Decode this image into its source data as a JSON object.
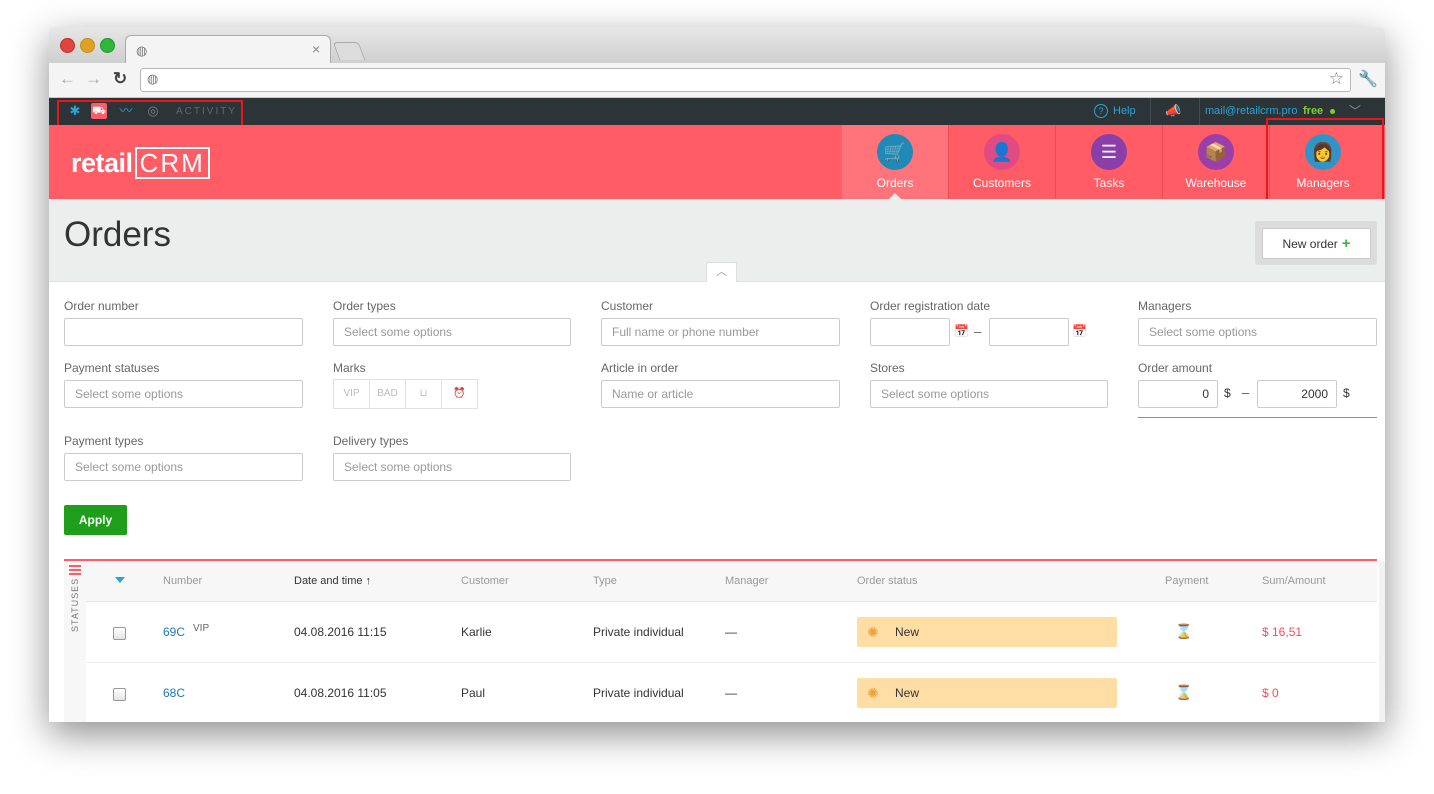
{
  "browser": {
    "tab_close": "×"
  },
  "topbar": {
    "activity": "ACTIVITY",
    "help": "Help",
    "email": "mail@retailcrm.pro",
    "plan": "free"
  },
  "logo": {
    "retail": "retail",
    "crm": "CRM"
  },
  "nav": [
    {
      "label": "Orders",
      "color": "#1f8ab8",
      "glyph": "cart-icon"
    },
    {
      "label": "Customers",
      "color": "#e14b83",
      "glyph": "person-icon"
    },
    {
      "label": "Tasks",
      "color": "#8a3ea8",
      "glyph": "list-icon"
    },
    {
      "label": "Warehouse",
      "color": "#9b3fa8",
      "glyph": "box-icon"
    },
    {
      "label": "Managers",
      "color": "#2f95c6",
      "glyph": "manager-icon"
    }
  ],
  "page": {
    "title": "Orders",
    "new_order": "New order"
  },
  "filters": {
    "order_number": {
      "label": "Order number",
      "placeholder": ""
    },
    "order_types": {
      "label": "Order types",
      "placeholder": "Select some options"
    },
    "customer": {
      "label": "Customer",
      "placeholder": "Full name or phone number"
    },
    "registration_date": {
      "label": "Order registration date",
      "dash": "–"
    },
    "managers": {
      "label": "Managers",
      "placeholder": "Select some options"
    },
    "payment_statuses": {
      "label": "Payment statuses",
      "placeholder": "Select some options"
    },
    "marks": {
      "label": "Marks",
      "items": [
        "VIP",
        "BAD"
      ]
    },
    "article": {
      "label": "Article in order",
      "placeholder": "Name or article"
    },
    "stores": {
      "label": "Stores",
      "placeholder": "Select some options"
    },
    "order_amount": {
      "label": "Order amount",
      "min": "0",
      "max": "2000",
      "currency": "$",
      "dash": "–"
    },
    "payment_types": {
      "label": "Payment types",
      "placeholder": "Select some options"
    },
    "delivery_types": {
      "label": "Delivery types",
      "placeholder": "Select some options"
    },
    "apply": "Apply"
  },
  "table": {
    "side_label": "STATUSES",
    "columns": {
      "number": "Number",
      "date": "Date and time ↑",
      "customer": "Customer",
      "type": "Type",
      "manager": "Manager",
      "status": "Order status",
      "payment": "Payment",
      "sum": "Sum/Amount"
    },
    "rows": [
      {
        "number": "69C",
        "mark": "VIP",
        "date": "04.08.2016 11:15",
        "customer": "Karlie",
        "type": "Private individual",
        "manager": "—",
        "status": "New",
        "sum": "$ 16,51"
      },
      {
        "number": "68C",
        "mark": "",
        "date": "04.08.2016 11:05",
        "customer": "Paul",
        "type": "Private individual",
        "manager": "—",
        "status": "New",
        "sum": "$ 0"
      }
    ]
  }
}
